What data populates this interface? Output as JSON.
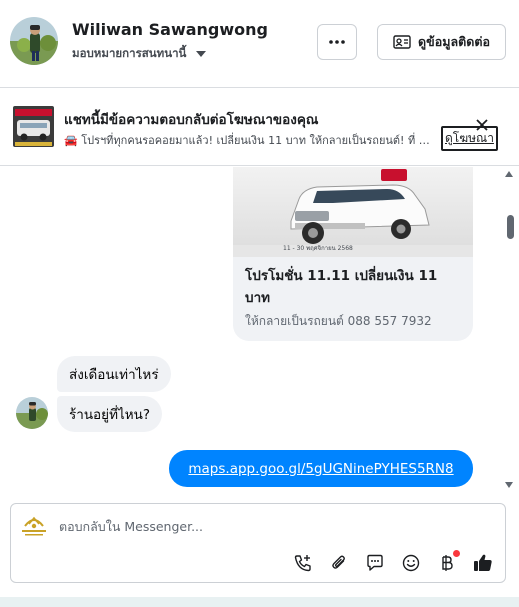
{
  "header": {
    "name": "Wiliwan Sawangwong",
    "assign_label": "มอบหมายการสนทนานี้",
    "more_icon": "more-horizontal-icon",
    "contact_button_label": "ดูข้อมูลติดต่อ"
  },
  "ad_banner": {
    "title": "แชทนี้มีข้อความตอบกลับต่อโฆษณาของคุณ",
    "subtitle": "🚘 โปรฯที่ทุกคนรอคอยมาแล้ว! เปลี่ยนเงิน 11 บาท ให้กลายเป็นรถยนต์! ที่ …",
    "view_ad_link": "ดูโฆษณา"
  },
  "ad_card": {
    "image_banner": "11 - 30 พฤศจิกายน 2568",
    "title": "โปรโมชั่น 11.11 เปลี่ยนเงิน 11 บาท",
    "subtitle": "ให้กลายเป็นรถยนต์ 088 557 7932"
  },
  "messages": [
    {
      "direction": "incoming",
      "text": "ส่งเดือนเท่าไหร่"
    },
    {
      "direction": "incoming",
      "text": "ร้านอยู่ที่ไหน?"
    },
    {
      "direction": "outgoing",
      "text": "maps.app.goo.gl/5gUGNinePYHES5RN8"
    }
  ],
  "composer": {
    "placeholder": "ตอบกลับใน Messenger...",
    "tools": [
      "call-add-icon",
      "paperclip-icon",
      "saved-reply-icon",
      "emoji-icon",
      "baht-payment-icon",
      "thumbs-up-icon"
    ]
  },
  "colors": {
    "accent": "#0084ff",
    "incoming_bubble": "#f0f2f5",
    "thumbs_up": "#1c1e21",
    "notification_dot": "#fa383e"
  }
}
